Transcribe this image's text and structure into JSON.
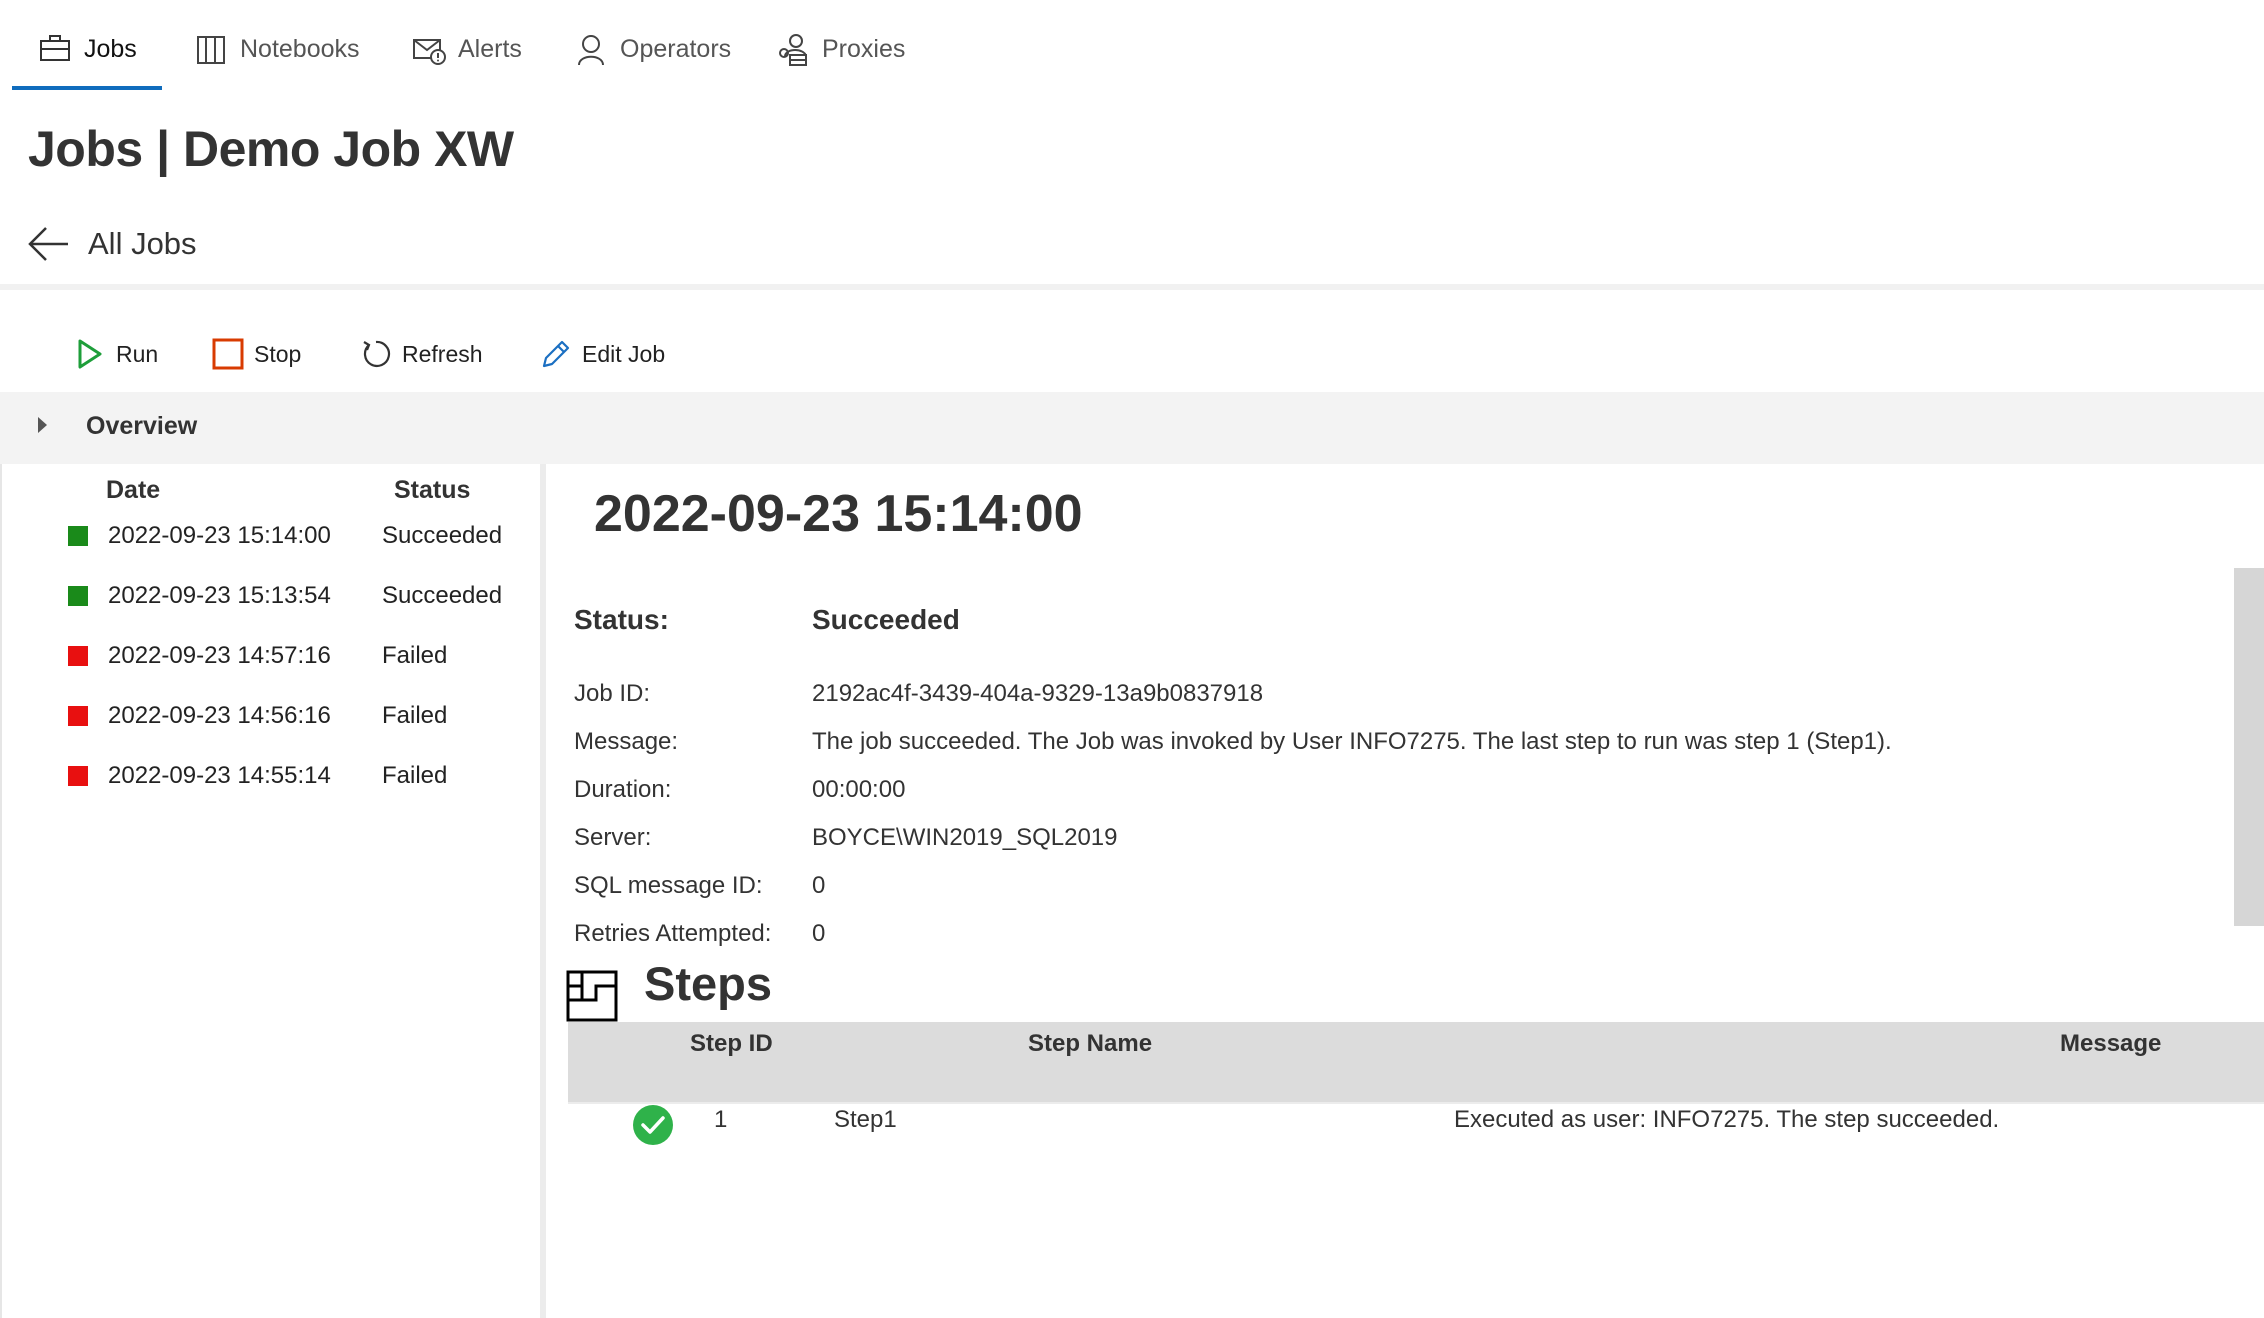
{
  "tabs": [
    {
      "label": "Jobs",
      "icon": "briefcase-icon",
      "active": true
    },
    {
      "label": "Notebooks",
      "icon": "notebook-icon",
      "active": false
    },
    {
      "label": "Alerts",
      "icon": "alert-icon",
      "active": false
    },
    {
      "label": "Operators",
      "icon": "person-icon",
      "active": false
    },
    {
      "label": "Proxies",
      "icon": "proxy-icon",
      "active": false
    }
  ],
  "page_title": "Jobs | Demo Job XW",
  "back_label": "All Jobs",
  "toolbar": {
    "run": "Run",
    "stop": "Stop",
    "refresh": "Refresh",
    "edit": "Edit Job"
  },
  "overview_label": "Overview",
  "history": {
    "col_date": "Date",
    "col_status": "Status",
    "rows": [
      {
        "date": "2022-09-23 15:14:00",
        "status": "Succeeded",
        "color": "#1a8a1a"
      },
      {
        "date": "2022-09-23 15:13:54",
        "status": "Succeeded",
        "color": "#1a8a1a"
      },
      {
        "date": "2022-09-23 14:57:16",
        "status": "Failed",
        "color": "#e81010"
      },
      {
        "date": "2022-09-23 14:56:16",
        "status": "Failed",
        "color": "#e81010"
      },
      {
        "date": "2022-09-23 14:55:14",
        "status": "Failed",
        "color": "#e81010"
      }
    ]
  },
  "detail": {
    "title": "2022-09-23 15:14:00",
    "status_label": "Status:",
    "status_value": "Succeeded",
    "job_id_label": "Job ID:",
    "job_id_value": "2192ac4f-3439-404a-9329-13a9b0837918",
    "message_label": "Message:",
    "message_value": "The job succeeded. The Job was invoked by User INFO7275. The last step to run was step 1 (Step1).",
    "duration_label": "Duration:",
    "duration_value": "00:00:00",
    "server_label": "Server:",
    "server_value": "BOYCE\\WIN2019_SQL2019",
    "sql_msg_label": "SQL message ID:",
    "sql_msg_value": "0",
    "retries_label": "Retries Attempted:",
    "retries_value": "0"
  },
  "steps": {
    "title": "Steps",
    "col_step_id": "Step ID",
    "col_step_name": "Step Name",
    "col_message": "Message",
    "rows": [
      {
        "id": "1",
        "name": "Step1",
        "message": "Executed as user: INFO7275. The step succeeded."
      }
    ]
  }
}
